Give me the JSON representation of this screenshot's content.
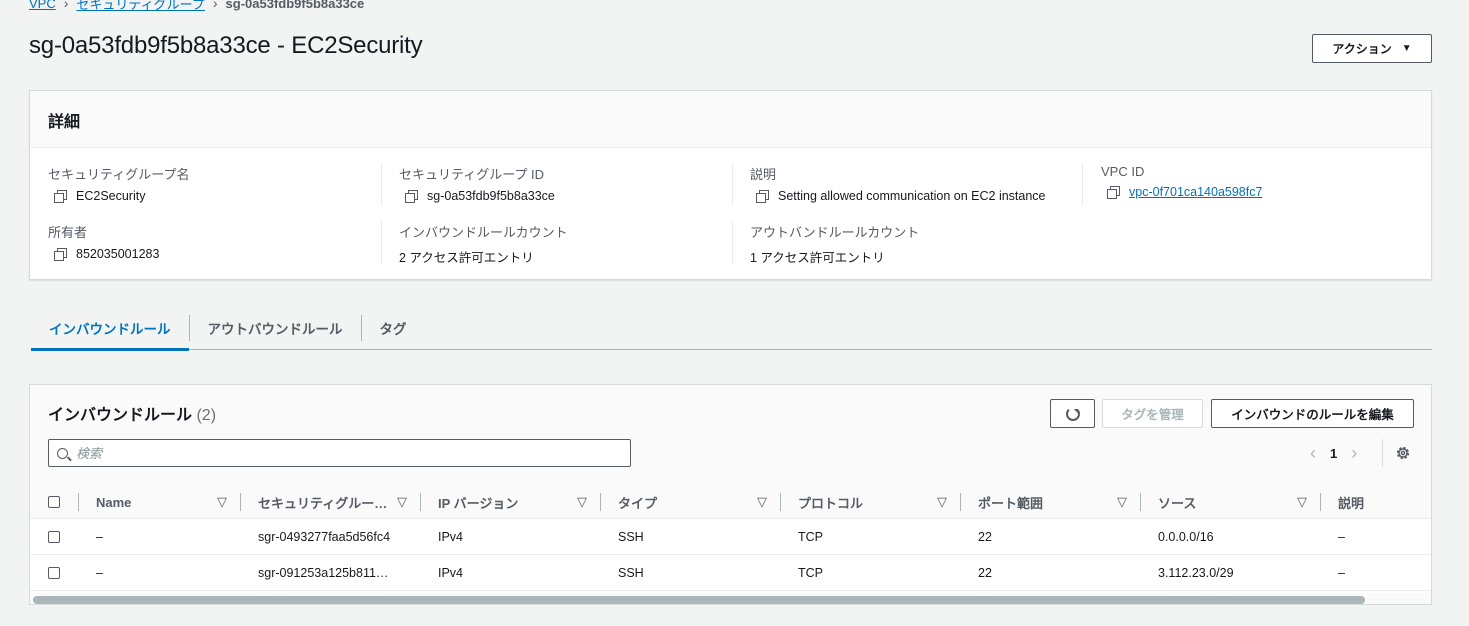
{
  "breadcrumb": {
    "items": [
      "VPC",
      "セキュリティグループ",
      "sg-0a53fdb9f5b8a33ce"
    ],
    "separator": "›"
  },
  "page": {
    "title": "sg-0a53fdb9f5b8a33ce - EC2Security",
    "action_label": "アクション"
  },
  "details": {
    "header": "詳細",
    "fields": [
      {
        "label": "セキュリティグループ名",
        "value": "EC2Security"
      },
      {
        "label": "セキュリティグループ ID",
        "value": "sg-0a53fdb9f5b8a33ce"
      },
      {
        "label": "説明",
        "value": "Setting allowed communication on EC2 instance"
      },
      {
        "label": "VPC ID",
        "value": "vpc-0f701ca140a598fc7"
      },
      {
        "label": "所有者",
        "value": "852035001283"
      },
      {
        "label": "インバウンドルールカウント",
        "value": "2 アクセス許可エントリ"
      },
      {
        "label": "アウトバンドルールカウント",
        "value": "1 アクセス許可エントリ"
      }
    ]
  },
  "tabs": [
    {
      "label": "インバウンドルール",
      "active": true
    },
    {
      "label": "アウトバウンドルール",
      "active": false
    },
    {
      "label": "タグ",
      "active": false
    }
  ],
  "rules": {
    "title": "インバウンドルール",
    "count": "(2)",
    "manage_tags_label": "タグを管理",
    "edit_label": "インバウンドのルールを編集",
    "search_placeholder": "検索",
    "page_number": "1",
    "columns": [
      "Name",
      "セキュリティグルー…",
      "IP バージョン",
      "タイプ",
      "プロトコル",
      "ポート範囲",
      "ソース",
      "説明"
    ],
    "rows": [
      [
        "–",
        "sgr-0493277faa5d56fc4",
        "IPv4",
        "SSH",
        "TCP",
        "22",
        "0.0.0.0/16",
        "–"
      ],
      [
        "–",
        "sgr-091253a125b811…",
        "IPv4",
        "SSH",
        "TCP",
        "22",
        "3.112.23.0/29",
        "–"
      ]
    ]
  },
  "colors": {
    "link": "#0073bb",
    "text": "#16191f",
    "muted": "#545b64",
    "background": "#f2f3f3"
  }
}
